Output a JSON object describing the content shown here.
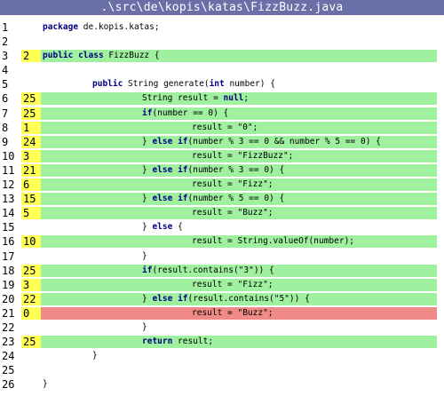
{
  "title": ".\\src\\de\\kopis\\katas\\FizzBuzz.java",
  "colors": {
    "title_bg": "#6a6fa8",
    "covered": "#9ff09f",
    "missed": "#f08a86",
    "hits": "#ffff55",
    "keyword": "#000080"
  },
  "lines": [
    {
      "n": "1",
      "hits": "",
      "status": "none",
      "indent": 0,
      "code": [
        [
          "kw",
          "package"
        ],
        [
          "t",
          " de.kopis.katas;"
        ]
      ]
    },
    {
      "n": "2",
      "hits": "",
      "status": "none",
      "indent": 0,
      "code": []
    },
    {
      "n": "3",
      "hits": "2",
      "status": "covered",
      "indent": 0,
      "code": [
        [
          "kw",
          "public"
        ],
        [
          "t",
          " "
        ],
        [
          "kw",
          "class"
        ],
        [
          "t",
          " FizzBuzz {"
        ]
      ]
    },
    {
      "n": "4",
      "hits": "",
      "status": "none",
      "indent": 0,
      "code": []
    },
    {
      "n": "5",
      "hits": "",
      "status": "none",
      "indent": 1,
      "code": [
        [
          "kw",
          "public"
        ],
        [
          "t",
          " String generate("
        ],
        [
          "kw",
          "int"
        ],
        [
          "t",
          " number) {"
        ]
      ]
    },
    {
      "n": "6",
      "hits": "25",
      "status": "covered",
      "indent": 2,
      "code": [
        [
          "t",
          "String result = "
        ],
        [
          "kw",
          "null"
        ],
        [
          "t",
          ";"
        ]
      ]
    },
    {
      "n": "7",
      "hits": "25",
      "status": "covered",
      "indent": 2,
      "code": [
        [
          "kw",
          "if"
        ],
        [
          "t",
          "(number == 0) {"
        ]
      ]
    },
    {
      "n": "8",
      "hits": "1",
      "status": "covered",
      "indent": 3,
      "code": [
        [
          "t",
          "result = \"0\";"
        ]
      ]
    },
    {
      "n": "9",
      "hits": "24",
      "status": "covered",
      "indent": 2,
      "code": [
        [
          "t",
          "} "
        ],
        [
          "kw",
          "else"
        ],
        [
          "t",
          " "
        ],
        [
          "kw",
          "if"
        ],
        [
          "t",
          "(number % 3 == 0 && number % 5 == 0) {"
        ]
      ]
    },
    {
      "n": "10",
      "hits": "3",
      "status": "covered",
      "indent": 3,
      "code": [
        [
          "t",
          "result = \"FizzBuzz\";"
        ]
      ]
    },
    {
      "n": "11",
      "hits": "21",
      "status": "covered",
      "indent": 2,
      "code": [
        [
          "t",
          "} "
        ],
        [
          "kw",
          "else"
        ],
        [
          "t",
          " "
        ],
        [
          "kw",
          "if"
        ],
        [
          "t",
          "(number % 3 == 0) {"
        ]
      ]
    },
    {
      "n": "12",
      "hits": "6",
      "status": "covered",
      "indent": 3,
      "code": [
        [
          "t",
          "result = \"Fizz\";"
        ]
      ]
    },
    {
      "n": "13",
      "hits": "15",
      "status": "covered",
      "indent": 2,
      "code": [
        [
          "t",
          "} "
        ],
        [
          "kw",
          "else"
        ],
        [
          "t",
          " "
        ],
        [
          "kw",
          "if"
        ],
        [
          "t",
          "(number % 5 == 0) {"
        ]
      ]
    },
    {
      "n": "14",
      "hits": "5",
      "status": "covered",
      "indent": 3,
      "code": [
        [
          "t",
          "result = \"Buzz\";"
        ]
      ]
    },
    {
      "n": "15",
      "hits": "",
      "status": "none",
      "indent": 2,
      "code": [
        [
          "t",
          "} "
        ],
        [
          "kw",
          "else"
        ],
        [
          "t",
          " {"
        ]
      ]
    },
    {
      "n": "16",
      "hits": "10",
      "status": "covered",
      "indent": 3,
      "code": [
        [
          "t",
          "result = String.valueOf(number);"
        ]
      ]
    },
    {
      "n": "17",
      "hits": "",
      "status": "none",
      "indent": 2,
      "code": [
        [
          "t",
          "}"
        ]
      ]
    },
    {
      "n": "18",
      "hits": "25",
      "status": "covered",
      "indent": 2,
      "code": [
        [
          "kw",
          "if"
        ],
        [
          "t",
          "(result.contains(\"3\")) {"
        ]
      ]
    },
    {
      "n": "19",
      "hits": "3",
      "status": "covered",
      "indent": 3,
      "code": [
        [
          "t",
          "result = \"Fizz\";"
        ]
      ]
    },
    {
      "n": "20",
      "hits": "22",
      "status": "covered",
      "indent": 2,
      "code": [
        [
          "t",
          "} "
        ],
        [
          "kw",
          "else"
        ],
        [
          "t",
          " "
        ],
        [
          "kw",
          "if"
        ],
        [
          "t",
          "(result.contains(\"5\")) {"
        ]
      ]
    },
    {
      "n": "21",
      "hits": "0",
      "status": "missed",
      "indent": 3,
      "code": [
        [
          "t",
          "result = \"Buzz\";"
        ]
      ]
    },
    {
      "n": "22",
      "hits": "",
      "status": "none",
      "indent": 2,
      "code": [
        [
          "t",
          "}"
        ]
      ]
    },
    {
      "n": "23",
      "hits": "25",
      "status": "covered",
      "indent": 2,
      "code": [
        [
          "kw",
          "return"
        ],
        [
          "t",
          " result;"
        ]
      ]
    },
    {
      "n": "24",
      "hits": "",
      "status": "none",
      "indent": 1,
      "code": [
        [
          "t",
          "}"
        ]
      ]
    },
    {
      "n": "25",
      "hits": "",
      "status": "none",
      "indent": 0,
      "code": []
    },
    {
      "n": "26",
      "hits": "",
      "status": "none",
      "indent": 0,
      "code": [
        [
          "t",
          "}"
        ]
      ]
    }
  ]
}
